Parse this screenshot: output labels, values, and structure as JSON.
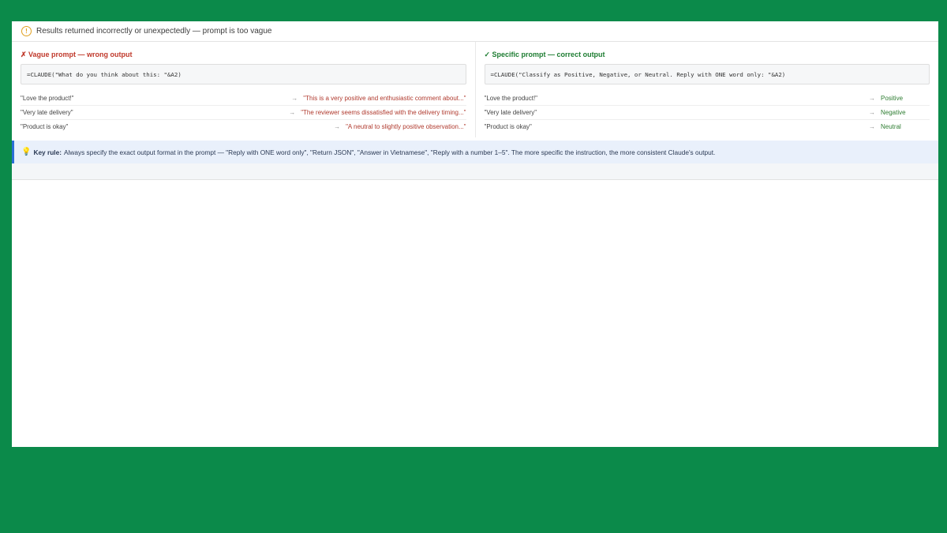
{
  "header": {
    "icon": "warning-circle-icon",
    "text": "Results returned incorrectly or unexpectedly — prompt is too vague"
  },
  "left_panel": {
    "title": "✗ Vague prompt — wrong output",
    "formula": "=CLAUDE(\"What do you think about this: \"&A2)",
    "rows": [
      {
        "input": "\"Love the product!\"",
        "arrow": "→",
        "output": "\"This is a very positive and enthusiastic comment about...\""
      },
      {
        "input": "\"Very late delivery\"",
        "arrow": "→",
        "output": "\"The reviewer seems dissatisfied with the delivery timing...\""
      },
      {
        "input": "\"Product is okay\"",
        "arrow": "→",
        "output": "\"A neutral to slightly positive observation...\""
      }
    ]
  },
  "right_panel": {
    "title": "✓ Specific prompt — correct output",
    "formula": "=CLAUDE(\"Classify as Positive, Negative, or Neutral. Reply with ONE word only: \"&A2)",
    "rows": [
      {
        "input": "\"Love the product!\"",
        "arrow": "→",
        "output": "Positive"
      },
      {
        "input": "\"Very late delivery\"",
        "arrow": "→",
        "output": "Negative"
      },
      {
        "input": "\"Product is okay\"",
        "arrow": "→",
        "output": "Neutral"
      }
    ]
  },
  "key_rule": {
    "icon": "lightbulb-icon",
    "label": "Key rule:",
    "text": "Always specify the exact output format in the prompt — \"Reply with ONE word only\", \"Return JSON\", \"Answer in Vietnamese\", \"Reply with a number 1–5\". The more specific the instruction, the more consistent Claude's output."
  },
  "colors": {
    "background": "#0b8a4a",
    "error": "#c0392b",
    "success": "#1e7d32",
    "warning": "#e0a020",
    "info_bg": "#e9f0fb",
    "info_border": "#2a6fd6"
  }
}
